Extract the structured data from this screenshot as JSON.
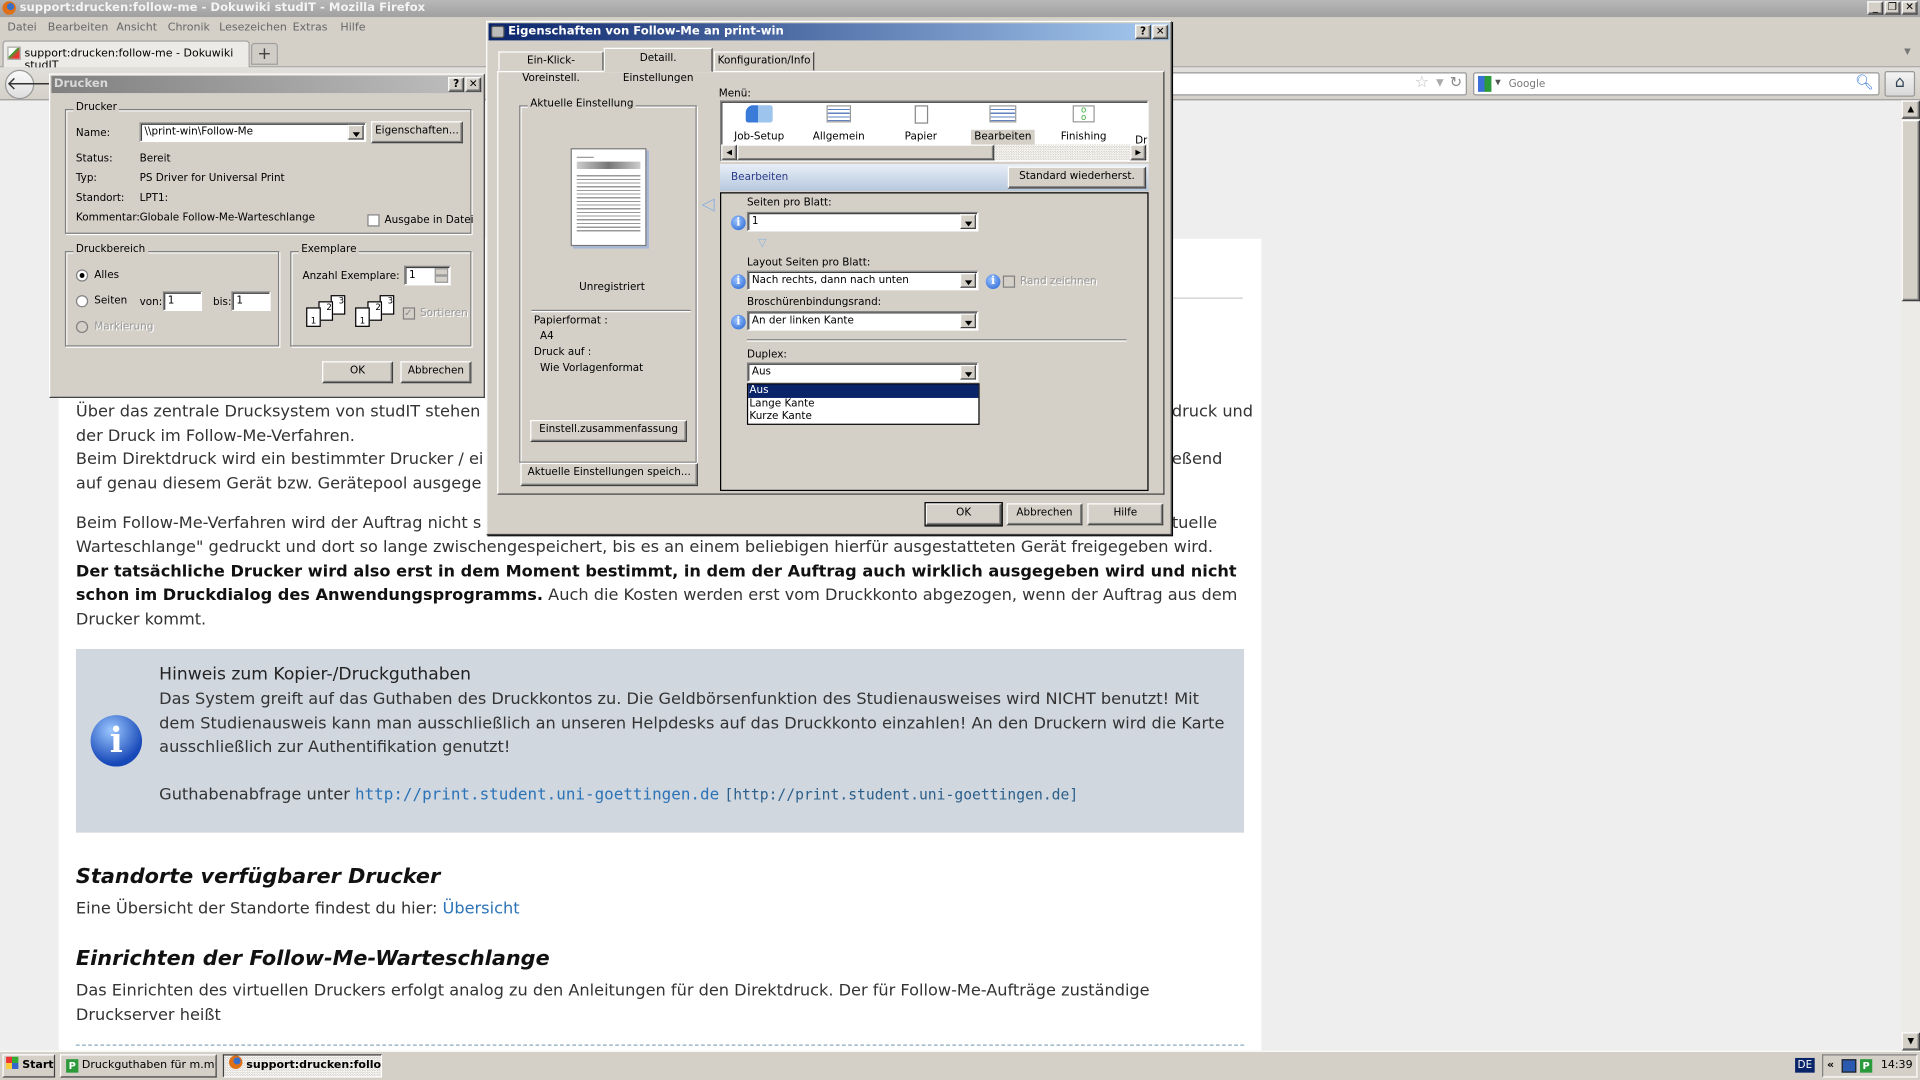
{
  "browser": {
    "title": "support:drucken:follow-me - Dokuwiki studIT - Mozilla Firefox",
    "menu": [
      "Datei",
      "Bearbeiten",
      "Ansicht",
      "Chronik",
      "Lesezeichen",
      "Extras",
      "Hilfe"
    ],
    "tab_label": "support:drucken:follow-me - Dokuwiki studIT",
    "new_tab": "+",
    "search_placeholder": "Google"
  },
  "page": {
    "p1a": "Über das zentrale Drucksystem von studIT stehen",
    "p1a_end": "druck und",
    "p1b": "der Druck im Follow-Me-Verfahren.",
    "p1c": "Beim Direktdruck wird ein bestimmter Drucker / ei",
    "p1c_end": "eßend",
    "p1d": "auf genau diesem Gerät bzw. Gerätepool ausgege",
    "p2a": "Beim Follow-Me-Verfahren wird der Auftrag nicht s",
    "p2a_end": "tuelle",
    "p2b": "Warteschlange\" gedruckt und dort so lange zwischengespeichert, bis es an einem beliebigen hierfür ausgestatteten Gerät freigegeben wird.",
    "p2_bold": "Der tatsächliche Drucker wird also erst in dem Moment bestimmt, in dem der Auftrag auch wirklich ausgegeben wird und nicht schon im Druckdialog des Anwendungsprogramms.",
    "p2_rest": " Auch die Kosten werden erst vom Druckkonto abgezogen, wenn der Auftrag aus dem Drucker kommt.",
    "note": {
      "title": "Hinweis zum Kopier-/Druckguthaben",
      "text": "Das System greift auf das Guthaben des Druckkontos zu. Die Geldbörsenfunktion des Studienausweises wird NICHT benutzt! Mit dem Studienausweis kann man ausschließlich an unseren Helpdesks auf das Druckkonto einzahlen! An den Druckern wird die Karte ausschließlich zur Authentifikation genutzt!",
      "link_prefix": "Guthabenabfrage unter ",
      "link": "http://print.student.uni-goettingen.de",
      "link_bracket": "[http://print.student.uni-goettingen.de]"
    },
    "h2_standorte": "Standorte verfügbarer Drucker",
    "standorte_text": "Eine Übersicht der Standorte findest du hier: ",
    "standorte_link": "Übersicht",
    "h2_einrichten": "Einrichten der Follow-Me-Warteschlange",
    "einrichten_text": "Das Einrichten des virtuellen Druckers erfolgt analog zu den Anleitungen für den Direktdruck. Der für Follow-Me-Aufträge zuständige Druckserver heißt"
  },
  "print_dialog": {
    "title": "Drucken",
    "drucker_group": "Drucker",
    "name_label": "Name:",
    "name_value": "\\\\print-win\\Follow-Me",
    "properties_button": "Eigenschaften...",
    "status_label": "Status:",
    "status_value": "Bereit",
    "typ_label": "Typ:",
    "typ_value": "PS Driver for Universal Print",
    "standort_label": "Standort:",
    "standort_value": "LPT1:",
    "kommentar_label": "Kommentar:",
    "kommentar_value": "Globale Follow-Me-Warteschlange",
    "to_file": "Ausgabe in Datei",
    "range_group": "Druckbereich",
    "all": "Alles",
    "pages": "Seiten",
    "from": "von:",
    "from_value": "1",
    "to": "bis:",
    "to_value": "1",
    "selection": "Markierung",
    "copies_group": "Exemplare",
    "copies_label": "Anzahl Exemplare:",
    "copies_value": "1",
    "collate": "Sortieren",
    "ok": "OK",
    "cancel": "Abbrechen"
  },
  "props_dialog": {
    "title": "Eigenschaften von Follow-Me an print-win",
    "tabs": [
      "Ein-Klick-Voreinstell.",
      "Detaill. Einstellungen",
      "Konfiguration/Info"
    ],
    "current_group": "Aktuelle Einstellung",
    "unregistered": "Unregistriert",
    "paper_label": "Papierformat :",
    "paper_value": "A4",
    "print_on_label": "Druck auf :",
    "print_on_value": "Wie Vorlagenformat",
    "summary_button": "Einstell.zusammenfassung",
    "save_button": "Aktuelle Einstellungen speich...",
    "menu_label": "Menü:",
    "menu_items": [
      "Job-Setup",
      "Allgemein",
      "Papier",
      "Bearbeiten",
      "Finishing",
      "Dr"
    ],
    "section_title": "Bearbeiten",
    "restore_button": "Standard wiederherst.",
    "pages_per_sheet_label": "Seiten pro Blatt:",
    "pages_per_sheet_value": "1",
    "layout_label": "Layout Seiten pro Blatt:",
    "layout_value": "Nach rechts, dann nach unten",
    "border_label": "Rand zeichnen",
    "binding_label": "Broschürenbindungsrand:",
    "binding_value": "An der linken Kante",
    "duplex_label": "Duplex:",
    "duplex_value": "Aus",
    "duplex_options": [
      "Aus",
      "Lange Kante",
      "Kurze Kante"
    ],
    "ok": "OK",
    "cancel": "Abbrechen",
    "help": "Hilfe"
  },
  "taskbar": {
    "start": "Start",
    "items": [
      "Druckguthaben für m.mu...",
      "support:drucken:follo..."
    ],
    "lang": "DE",
    "tray_expand": "«",
    "clock": "14:39"
  },
  "colors": {
    "active_title": "#0a246a",
    "selection": "#0a246a",
    "link": "#2b73b7",
    "note_bg": "#d1d7df"
  }
}
